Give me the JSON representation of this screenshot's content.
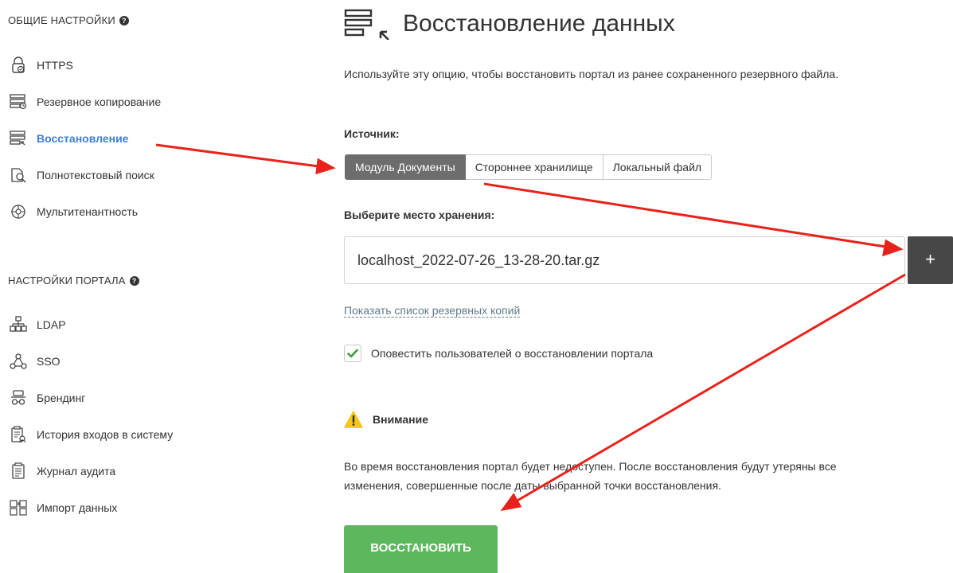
{
  "sidebar": {
    "general_title": "ОБЩИЕ НАСТРОЙКИ",
    "general_items": [
      {
        "label": "HTTPS",
        "icon": "lock-icon"
      },
      {
        "label": "Резервное копирование",
        "icon": "backup-server-icon"
      },
      {
        "label": "Восстановление",
        "icon": "restore-server-icon",
        "active": true
      },
      {
        "label": "Полнотекстовый поиск",
        "icon": "fulltext-search-icon"
      },
      {
        "label": "Мультитенантность",
        "icon": "globe-icon"
      }
    ],
    "portal_title": "НАСТРОЙКИ ПОРТАЛА",
    "portal_items": [
      {
        "label": "LDAP",
        "icon": "ldap-tree-icon"
      },
      {
        "label": "SSO",
        "icon": "sso-network-icon"
      },
      {
        "label": "Брендинг",
        "icon": "branding-icon"
      },
      {
        "label": "История входов в систему",
        "icon": "login-history-icon"
      },
      {
        "label": "Журнал аудита",
        "icon": "audit-log-icon"
      },
      {
        "label": "Импорт данных",
        "icon": "data-import-icon"
      }
    ]
  },
  "main": {
    "title": "Восстановление данных",
    "description": "Используйте эту опцию, чтобы восстановить портал из ранее сохраненного резервного файла.",
    "source_label": "Источник:",
    "source_tabs": [
      {
        "label": "Модуль Документы",
        "active": true
      },
      {
        "label": "Стороннее хранилище"
      },
      {
        "label": "Локальный файл"
      }
    ],
    "storage_label": "Выберите место хранения:",
    "storage_value": "localhost_2022-07-26_13-28-20.tar.gz",
    "plus_label": "+",
    "show_backups_link": "Показать список резервных копий",
    "notify_label": "Оповестить пользователей о восстановлении портала",
    "notify_checked": true,
    "warning_title": "Внимание",
    "warning_line1": "Во время восстановления портал будет недоступен. После восстановления будут утеряны все",
    "warning_line2": "изменения, совершенные после даты выбранной точки восстановления.",
    "restore_button": "ВОССТАНОВИТЬ"
  },
  "colors": {
    "accent": "#3d7fd6",
    "restore_button": "#5cb85c",
    "active_tab": "#6d6d6d",
    "annotation_arrow": "#e8221b",
    "warning": "#f5c518"
  }
}
